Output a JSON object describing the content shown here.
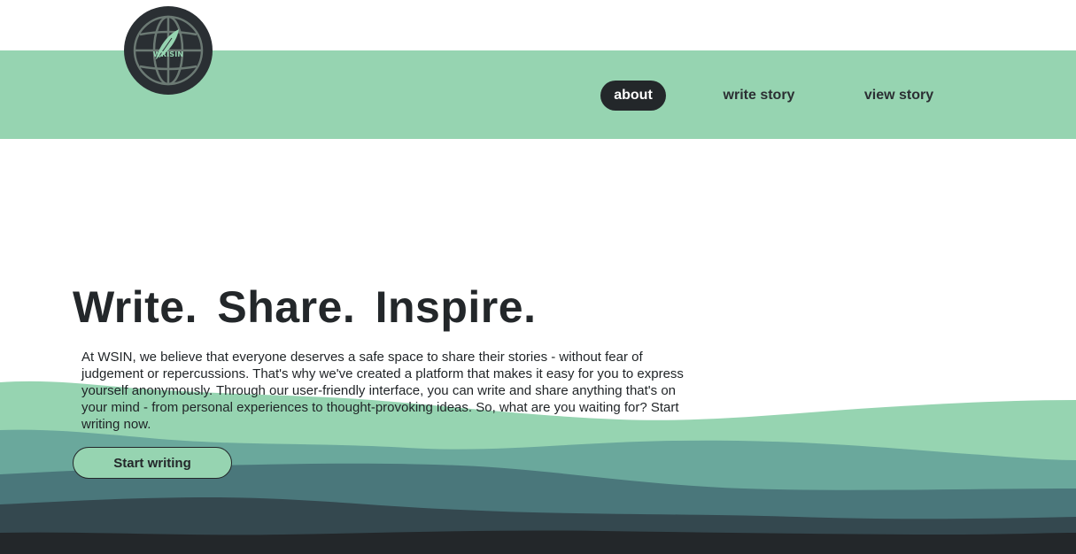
{
  "brand": {
    "logo_text": "WRISIN",
    "colors": {
      "mint": "#96d4b1",
      "dark": "#23272a",
      "teal": "#6aa89c",
      "slate": "#4a777b",
      "deep": "#34484f"
    }
  },
  "nav": {
    "items": [
      {
        "label": "about",
        "active": true
      },
      {
        "label": "write story",
        "active": false
      },
      {
        "label": "view story",
        "active": false
      }
    ]
  },
  "hero": {
    "title": "Write.  Share.  Inspire.",
    "body": "At WSIN, we believe that everyone deserves a safe space to share their stories - without fear of judgement or repercussions. That's why we've created a platform that makes it easy for you to express yourself anonymously. Through our user-friendly interface, you can write and share anything that's on your mind - from personal experiences to thought-provoking ideas. So, what are you waiting for? Start writing now.",
    "cta_label": "Start writing"
  }
}
